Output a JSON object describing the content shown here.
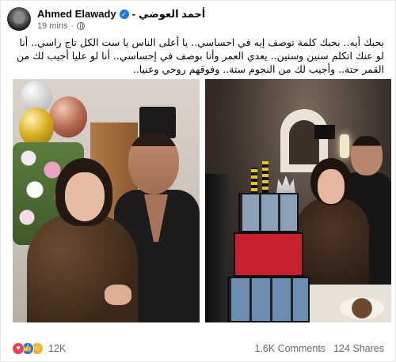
{
  "post": {
    "author_en": "Ahmed Elawady",
    "separator": "-",
    "author_ar": "أحمد العوضي",
    "time": "19 mins",
    "time_sep": "·",
    "verified_glyph": "✓",
    "text": "بحبك أيه.. بحبك كلمة توصف إيه في احساسي.. يا أعلى الناس يا ست الكل تاج راسي.. أنا لو عنك اتكلم سنين وسنين.. يعدي العمر وأنا بوصف في إحساسي.. أنا لو عليا أجيب لك من القمر حتة.. وأجيب لك من النجوم ستة.. وفوقهم روحي وعنيا.."
  },
  "reactions": {
    "icons": [
      "love-icon",
      "like-icon",
      "care-icon"
    ],
    "love_glyph": "♥",
    "like_glyph": "👍",
    "care_glyph": "☺",
    "count": "12K"
  },
  "stats": {
    "comments": "1.6K Comments",
    "shares": "124 Shares"
  }
}
